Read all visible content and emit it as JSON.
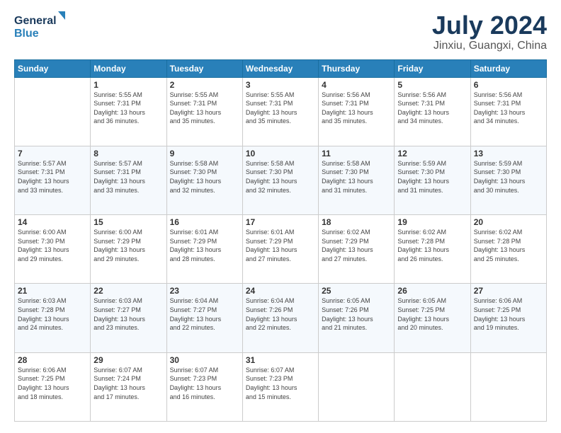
{
  "logo": {
    "line1": "General",
    "line2": "Blue"
  },
  "title": "July 2024",
  "location": "Jinxiu, Guangxi, China",
  "weekdays": [
    "Sunday",
    "Monday",
    "Tuesday",
    "Wednesday",
    "Thursday",
    "Friday",
    "Saturday"
  ],
  "weeks": [
    [
      {
        "day": "",
        "info": ""
      },
      {
        "day": "1",
        "info": "Sunrise: 5:55 AM\nSunset: 7:31 PM\nDaylight: 13 hours\nand 36 minutes."
      },
      {
        "day": "2",
        "info": "Sunrise: 5:55 AM\nSunset: 7:31 PM\nDaylight: 13 hours\nand 35 minutes."
      },
      {
        "day": "3",
        "info": "Sunrise: 5:55 AM\nSunset: 7:31 PM\nDaylight: 13 hours\nand 35 minutes."
      },
      {
        "day": "4",
        "info": "Sunrise: 5:56 AM\nSunset: 7:31 PM\nDaylight: 13 hours\nand 35 minutes."
      },
      {
        "day": "5",
        "info": "Sunrise: 5:56 AM\nSunset: 7:31 PM\nDaylight: 13 hours\nand 34 minutes."
      },
      {
        "day": "6",
        "info": "Sunrise: 5:56 AM\nSunset: 7:31 PM\nDaylight: 13 hours\nand 34 minutes."
      }
    ],
    [
      {
        "day": "7",
        "info": "Sunrise: 5:57 AM\nSunset: 7:31 PM\nDaylight: 13 hours\nand 33 minutes."
      },
      {
        "day": "8",
        "info": "Sunrise: 5:57 AM\nSunset: 7:31 PM\nDaylight: 13 hours\nand 33 minutes."
      },
      {
        "day": "9",
        "info": "Sunrise: 5:58 AM\nSunset: 7:30 PM\nDaylight: 13 hours\nand 32 minutes."
      },
      {
        "day": "10",
        "info": "Sunrise: 5:58 AM\nSunset: 7:30 PM\nDaylight: 13 hours\nand 32 minutes."
      },
      {
        "day": "11",
        "info": "Sunrise: 5:58 AM\nSunset: 7:30 PM\nDaylight: 13 hours\nand 31 minutes."
      },
      {
        "day": "12",
        "info": "Sunrise: 5:59 AM\nSunset: 7:30 PM\nDaylight: 13 hours\nand 31 minutes."
      },
      {
        "day": "13",
        "info": "Sunrise: 5:59 AM\nSunset: 7:30 PM\nDaylight: 13 hours\nand 30 minutes."
      }
    ],
    [
      {
        "day": "14",
        "info": "Sunrise: 6:00 AM\nSunset: 7:30 PM\nDaylight: 13 hours\nand 29 minutes."
      },
      {
        "day": "15",
        "info": "Sunrise: 6:00 AM\nSunset: 7:29 PM\nDaylight: 13 hours\nand 29 minutes."
      },
      {
        "day": "16",
        "info": "Sunrise: 6:01 AM\nSunset: 7:29 PM\nDaylight: 13 hours\nand 28 minutes."
      },
      {
        "day": "17",
        "info": "Sunrise: 6:01 AM\nSunset: 7:29 PM\nDaylight: 13 hours\nand 27 minutes."
      },
      {
        "day": "18",
        "info": "Sunrise: 6:02 AM\nSunset: 7:29 PM\nDaylight: 13 hours\nand 27 minutes."
      },
      {
        "day": "19",
        "info": "Sunrise: 6:02 AM\nSunset: 7:28 PM\nDaylight: 13 hours\nand 26 minutes."
      },
      {
        "day": "20",
        "info": "Sunrise: 6:02 AM\nSunset: 7:28 PM\nDaylight: 13 hours\nand 25 minutes."
      }
    ],
    [
      {
        "day": "21",
        "info": "Sunrise: 6:03 AM\nSunset: 7:28 PM\nDaylight: 13 hours\nand 24 minutes."
      },
      {
        "day": "22",
        "info": "Sunrise: 6:03 AM\nSunset: 7:27 PM\nDaylight: 13 hours\nand 23 minutes."
      },
      {
        "day": "23",
        "info": "Sunrise: 6:04 AM\nSunset: 7:27 PM\nDaylight: 13 hours\nand 22 minutes."
      },
      {
        "day": "24",
        "info": "Sunrise: 6:04 AM\nSunset: 7:26 PM\nDaylight: 13 hours\nand 22 minutes."
      },
      {
        "day": "25",
        "info": "Sunrise: 6:05 AM\nSunset: 7:26 PM\nDaylight: 13 hours\nand 21 minutes."
      },
      {
        "day": "26",
        "info": "Sunrise: 6:05 AM\nSunset: 7:25 PM\nDaylight: 13 hours\nand 20 minutes."
      },
      {
        "day": "27",
        "info": "Sunrise: 6:06 AM\nSunset: 7:25 PM\nDaylight: 13 hours\nand 19 minutes."
      }
    ],
    [
      {
        "day": "28",
        "info": "Sunrise: 6:06 AM\nSunset: 7:25 PM\nDaylight: 13 hours\nand 18 minutes."
      },
      {
        "day": "29",
        "info": "Sunrise: 6:07 AM\nSunset: 7:24 PM\nDaylight: 13 hours\nand 17 minutes."
      },
      {
        "day": "30",
        "info": "Sunrise: 6:07 AM\nSunset: 7:23 PM\nDaylight: 13 hours\nand 16 minutes."
      },
      {
        "day": "31",
        "info": "Sunrise: 6:07 AM\nSunset: 7:23 PM\nDaylight: 13 hours\nand 15 minutes."
      },
      {
        "day": "",
        "info": ""
      },
      {
        "day": "",
        "info": ""
      },
      {
        "day": "",
        "info": ""
      }
    ]
  ]
}
